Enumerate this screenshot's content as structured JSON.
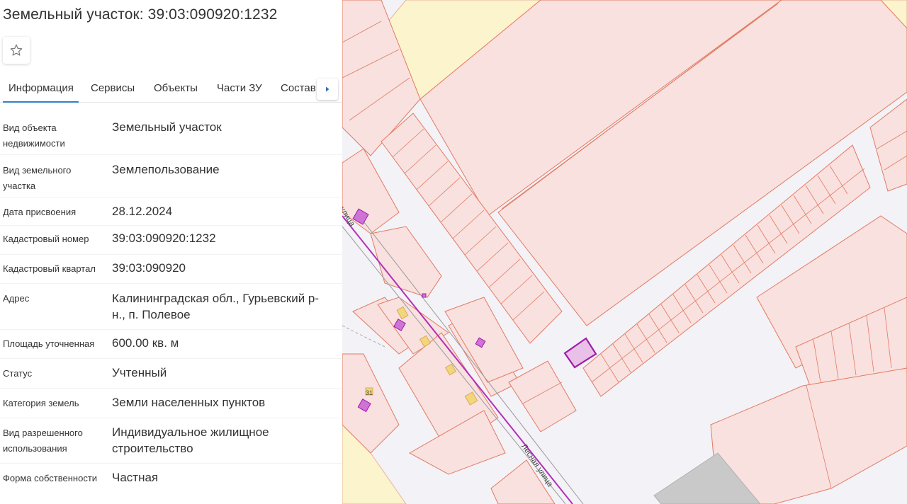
{
  "header": {
    "title": "Земельный участок: 39:03:090920:1232"
  },
  "icons": {
    "favorite": "star-outline-icon",
    "tabs_scroll": "caret-right-icon"
  },
  "tabs": [
    {
      "label": "Информация",
      "active": true
    },
    {
      "label": "Сервисы",
      "active": false
    },
    {
      "label": "Объекты",
      "active": false
    },
    {
      "label": "Части ЗУ",
      "active": false
    },
    {
      "label": "Состав",
      "active": false
    }
  ],
  "info": {
    "rows": [
      {
        "label": "Вид объекта недвижимости",
        "value": "Земельный участок"
      },
      {
        "label": "Вид земельного участка",
        "value": "Землепользование"
      },
      {
        "label": "Дата присвоения",
        "value": "28.12.2024"
      },
      {
        "label": "Кадастровый номер",
        "value": "39:03:090920:1232"
      },
      {
        "label": "Кадастровый квартал",
        "value": "39:03:090920"
      },
      {
        "label": "Адрес",
        "value": "Калининградская обл., Гурьевский р-н., п. Полевое"
      },
      {
        "label": "Площадь уточненная",
        "value": "600.00 кв. м"
      },
      {
        "label": "Статус",
        "value": "Учтенный"
      },
      {
        "label": "Категория земель",
        "value": "Земли населенных пунктов"
      },
      {
        "label": "Вид разрешенного использования",
        "value": "Индивидуальное жилищное строительство"
      },
      {
        "label": "Форма собственности",
        "value": "Частная"
      }
    ]
  },
  "map": {
    "road_labels": [
      "Лесная улица",
      "улица",
      "31"
    ],
    "colors": {
      "parcel_fill": "#f8e1df",
      "parcel_stroke": "#e37a62",
      "road": "#f3f2f7",
      "field": "#fbf4cc",
      "selected_parcel": "#a01ba8",
      "building": "#cf73d6",
      "rail": "#b32fb8"
    }
  }
}
